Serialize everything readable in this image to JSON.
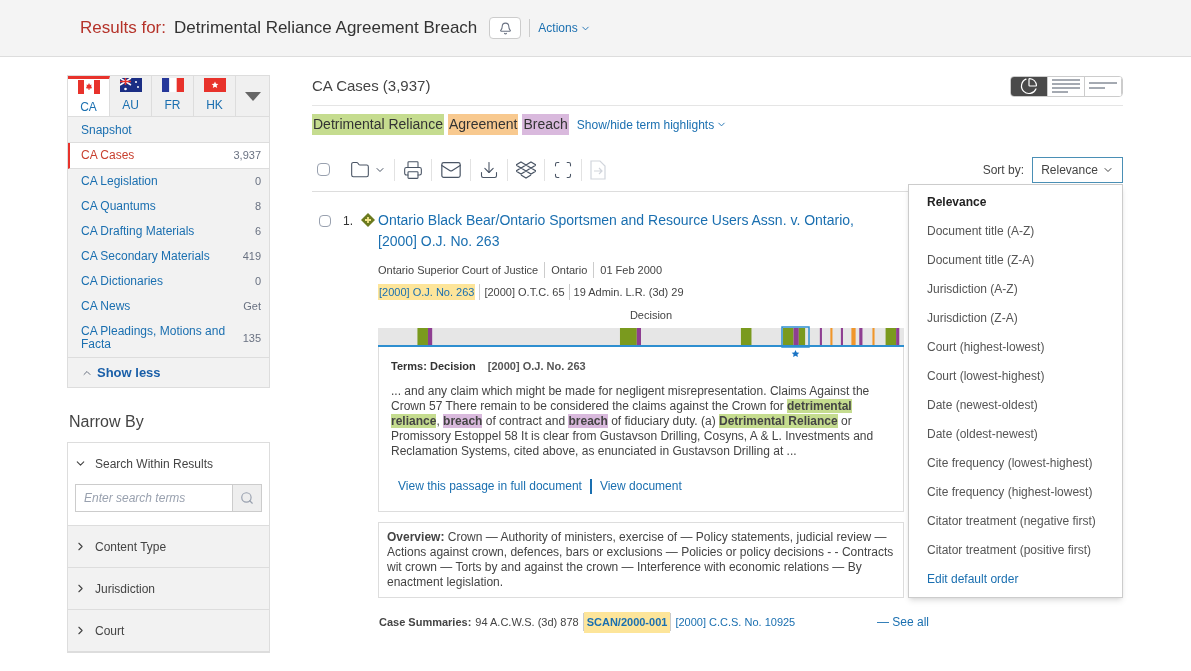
{
  "header": {
    "label": "Results for:",
    "query": "Detrimental Reliance Agreement Breach",
    "actions": "Actions"
  },
  "country_tabs": [
    {
      "code": "CA",
      "kind": "ca",
      "selected": true
    },
    {
      "code": "AU",
      "kind": "au",
      "selected": false
    },
    {
      "code": "FR",
      "kind": "fr",
      "selected": false
    },
    {
      "code": "HK",
      "kind": "hk",
      "selected": false
    }
  ],
  "snapshot": "Snapshot",
  "content_types": [
    {
      "label": "CA Cases",
      "count": "3,937",
      "selected": true
    },
    {
      "label": "CA Legislation",
      "count": "0",
      "selected": false
    },
    {
      "label": "CA Quantums",
      "count": "8",
      "selected": false
    },
    {
      "label": "CA Drafting Materials",
      "count": "6",
      "selected": false
    },
    {
      "label": "CA Secondary Materials",
      "count": "419",
      "selected": false
    },
    {
      "label": "CA Dictionaries",
      "count": "0",
      "selected": false
    },
    {
      "label": "CA News",
      "count": "Get",
      "selected": false
    },
    {
      "label": "CA Pleadings, Motions and Facta",
      "count": "135",
      "selected": false
    }
  ],
  "show_less": "Show less",
  "narrow_by": {
    "title": "Narrow By",
    "sections": [
      {
        "label": "Search Within Results",
        "expanded": true,
        "placeholder": "Enter search terms"
      },
      {
        "label": "Content Type",
        "expanded": false
      },
      {
        "label": "Jurisdiction",
        "expanded": false
      },
      {
        "label": "Court",
        "expanded": false
      }
    ]
  },
  "results_title": "CA Cases (3,937)",
  "view_buttons": [
    {
      "kind": "chart",
      "selected": true
    },
    {
      "kind": "full",
      "selected": false
    },
    {
      "kind": "brief",
      "selected": false
    }
  ],
  "terms": [
    {
      "text": "Detrimental Reliance",
      "color": "#c5dc8f"
    },
    {
      "text": "Agreement",
      "color": "#f8c98f"
    },
    {
      "text": "Breach",
      "color": "#d9b9dd"
    }
  ],
  "terms_toggle": "Show/hide term highlights",
  "toolbar": [
    {
      "kind": "checkbox",
      "checked": false
    },
    {
      "kind": "folder"
    },
    {
      "kind": "print"
    },
    {
      "kind": "email"
    },
    {
      "kind": "download"
    },
    {
      "kind": "dropbox"
    },
    {
      "kind": "frame"
    },
    {
      "kind": "export",
      "disabled": true
    }
  ],
  "sort": {
    "label": "Sort by:",
    "value": "Relevance",
    "options": [
      {
        "label": "Relevance",
        "selected": true,
        "kind": "option"
      },
      {
        "label": "Document title (A-Z)",
        "selected": false,
        "kind": "option"
      },
      {
        "label": "Document title (Z-A)",
        "selected": false,
        "kind": "option"
      },
      {
        "label": "Jurisdiction (A-Z)",
        "selected": false,
        "kind": "option"
      },
      {
        "label": "Jurisdiction (Z-A)",
        "selected": false,
        "kind": "option"
      },
      {
        "label": "Court (highest-lowest)",
        "selected": false,
        "kind": "option"
      },
      {
        "label": "Court (lowest-highest)",
        "selected": false,
        "kind": "option"
      },
      {
        "label": "Date (newest-oldest)",
        "selected": false,
        "kind": "option"
      },
      {
        "label": "Date (oldest-newest)",
        "selected": false,
        "kind": "option"
      },
      {
        "label": "Cite frequency (lowest-highest)",
        "selected": false,
        "kind": "option"
      },
      {
        "label": "Cite frequency (highest-lowest)",
        "selected": false,
        "kind": "option"
      },
      {
        "label": "Citator treatment (negative first)",
        "selected": false,
        "kind": "option"
      },
      {
        "label": "Citator treatment (positive first)",
        "selected": false,
        "kind": "option"
      },
      {
        "label": "Edit default order",
        "kind": "link"
      }
    ]
  },
  "result": {
    "number": "1.",
    "checked": false,
    "title": "Ontario Black Bear/Ontario Sportsmen and Resource Users Assn. v. Ontario,",
    "title_line2": "[2000] O.J. No. 263",
    "meta": [
      "Ontario Superior Court of Justice",
      "Ontario",
      "01 Feb 2000"
    ],
    "citations": [
      {
        "text": "[2000] O.J. No. 263",
        "highlighted": true
      },
      {
        "text": "[2000] O.T.C. 65",
        "highlighted": false
      },
      {
        "text": "19 Admin. L.R. (3d) 29",
        "highlighted": false
      }
    ],
    "timeline_label": "Decision",
    "passage": {
      "terms_label": "Terms:",
      "section": "Decision",
      "citation": "[2000] O.J. No. 263",
      "snippet": [
        {
          "text": "... and any claim which might be made for negligent misrepresentation. Claims Against the Crown 57 There remain to be considered the claims against the Crown for "
        },
        {
          "text": "detrimental reliance",
          "color": "#c5dc8f"
        },
        {
          "text": ", "
        },
        {
          "text": "breach",
          "color": "#d9b9dd"
        },
        {
          "text": " of contract and "
        },
        {
          "text": "breach",
          "color": "#d9b9dd"
        },
        {
          "text": " of fiduciary duty. (a) "
        },
        {
          "text": "Detrimental Reliance",
          "color": "#c5dc8f"
        },
        {
          "text": " or Promissory Estoppel 58 It is clear from Gustavson Drilling, Cosyns, A & L. Investments and Reclamation Systems, cited above, as enunciated in Gustavson Drilling at ..."
        }
      ],
      "links": [
        "View this passage in full document",
        "View document"
      ]
    },
    "overview_label": "Overview:",
    "overview": "Crown — Authority of ministers, exercise of — Policy statements, judicial review — Actions against crown, defences, bars or exclusions — Policies or policy decisions - - Contracts wit crown — Torts by and against the crown — Interference with economic relations — By enactment legislation.",
    "summaries_label": "Case Summaries:",
    "summaries": [
      {
        "text": "94 A.C.W.S. (3d) 878",
        "kind": "plain"
      },
      {
        "text": "SCAN/2000-001",
        "kind": "highlight"
      },
      {
        "text": "[2000] C.C.S. No. 10925",
        "kind": "link"
      }
    ],
    "see_all": "— See all"
  }
}
